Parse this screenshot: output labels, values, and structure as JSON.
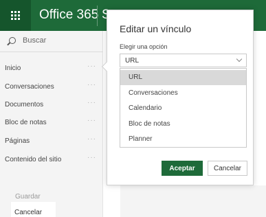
{
  "header": {
    "app_name": "Office 365",
    "truncated_label": "S",
    "waffle_icon": "app-launcher-icon"
  },
  "sidebar": {
    "search": {
      "placeholder": "Buscar",
      "icon": "search-icon"
    },
    "nav_items": [
      {
        "label": "Inicio",
        "more": "···"
      },
      {
        "label": "Conversaciones",
        "more": "···"
      },
      {
        "label": "Documentos",
        "more": "···"
      },
      {
        "label": "Bloc de notas",
        "more": "···"
      },
      {
        "label": "Páginas",
        "more": "···"
      },
      {
        "label": "Contenido del sitio",
        "more": "···"
      }
    ],
    "save_label": "Guardar",
    "cancel_label": "Cancelar"
  },
  "dialog": {
    "title": "Editar un vínculo",
    "choose_label": "Elegir una opción",
    "selected_value": "URL",
    "options": [
      "URL",
      "Conversaciones",
      "Calendario",
      "Bloc de notas",
      "Planner"
    ],
    "selected_index": 0,
    "accept_label": "Aceptar",
    "cancel_label": "Cancelar"
  },
  "colors": {
    "brand": "#1e6a39",
    "brand_dark": "#15552c",
    "selected_option": "#d9d9d9"
  }
}
